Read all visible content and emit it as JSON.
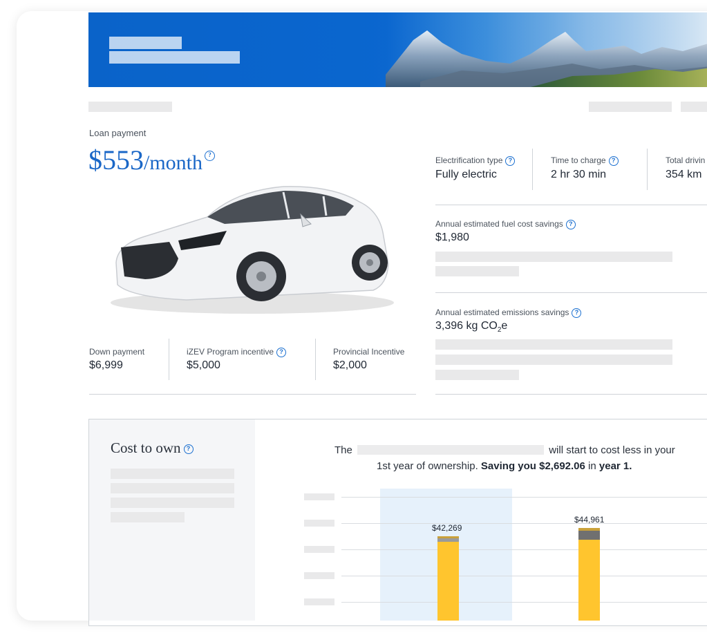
{
  "loan": {
    "label": "Loan payment",
    "amount": "$553",
    "unit": "/month",
    "help_icon": "help-circle-icon"
  },
  "specs": [
    {
      "label": "Electrification type",
      "value": "Fully electric"
    },
    {
      "label": "Time to charge",
      "value": "2 hr 30 min"
    },
    {
      "label": "Total drivin",
      "value": "354 km"
    }
  ],
  "savings": {
    "fuel_label": "Annual estimated fuel cost savings",
    "fuel_value": "$1,980",
    "emissions_label": "Annual estimated emissions savings",
    "emissions_value_main": "3,396 kg CO",
    "emissions_value_sub": "2",
    "emissions_value_end": "e"
  },
  "incentives": [
    {
      "label": "Down payment",
      "value": "$6,999"
    },
    {
      "label": "iZEV Program incentive",
      "value": "$5,000"
    },
    {
      "label": "Provincial Incentive",
      "value": "$2,000"
    }
  ],
  "cost_to_own": {
    "title": "Cost to own",
    "headline_start": "The",
    "headline_mid": "will start to cost less in your",
    "line2_start": "1st year of ownership.",
    "line2_saving": "Saving you",
    "line2_amount": "$2,692.06",
    "line2_in": "in",
    "line2_year": "year 1."
  },
  "chart_data": {
    "type": "bar",
    "stacked": true,
    "categories": [
      "",
      ""
    ],
    "data_labels": [
      "$42,269",
      "$44,961"
    ],
    "colors": {
      "main": "#ffc52e",
      "secondary": "#707070",
      "cap": "#c9a13a",
      "highlight": "#e6f1fb"
    }
  },
  "colors": {
    "accent": "#1a67c7",
    "hero": "#0a66cf"
  }
}
